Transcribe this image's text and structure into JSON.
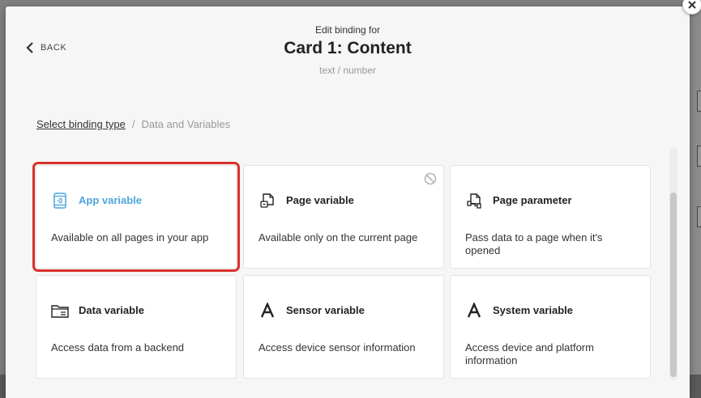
{
  "modal": {
    "eyebrow": "Edit binding for",
    "title": "Card 1: Content",
    "subtitle": "text / number",
    "back_label": "BACK"
  },
  "breadcrumb": {
    "link": "Select binding type",
    "separator": "/",
    "current": "Data and Variables"
  },
  "cards": [
    {
      "title": "App variable",
      "description": "Available on all pages in your app",
      "icon": "app-variable-icon",
      "selected": true
    },
    {
      "title": "Page variable",
      "description": "Available only on the current page",
      "icon": "page-variable-icon",
      "disabled_icon": "blocked-icon"
    },
    {
      "title": "Page parameter",
      "description": "Pass data to a page when it's opened",
      "icon": "page-parameter-icon"
    },
    {
      "title": "Data variable",
      "description": "Access data from a backend",
      "icon": "data-variable-icon"
    },
    {
      "title": "Sensor variable",
      "description": "Access device sensor information",
      "icon": "sensor-variable-icon"
    },
    {
      "title": "System variable",
      "description": "Access device and platform information",
      "icon": "system-variable-icon"
    }
  ],
  "colors": {
    "accent": "#4da5dc",
    "highlight": "#d9302a"
  }
}
